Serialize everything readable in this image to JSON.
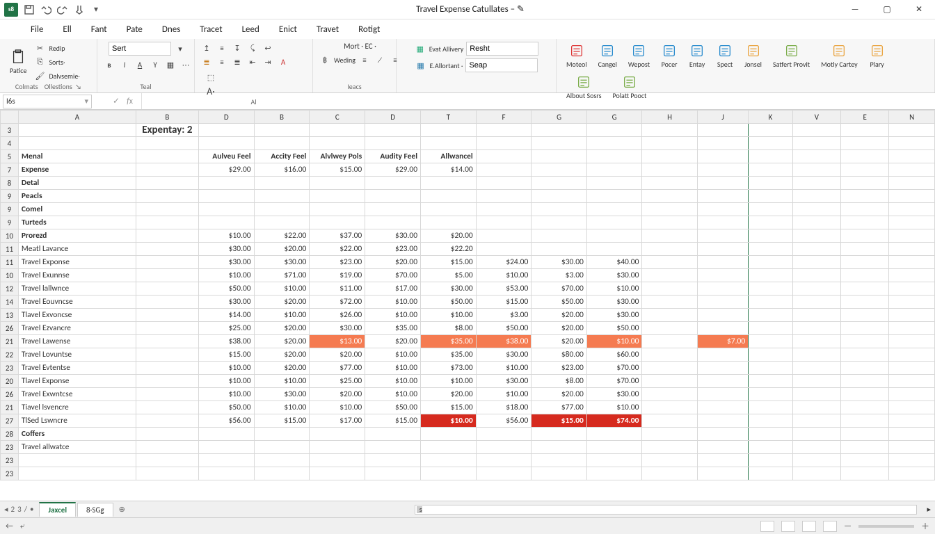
{
  "app": {
    "qat_label": "s8",
    "title": "Travel Expense Catullates  –  ✎"
  },
  "menu": [
    "File",
    "Ell",
    "Fant",
    "Pate",
    "Dnes",
    "Tracet",
    "Leed",
    "Enict",
    "Travet",
    "Rotigt"
  ],
  "ribbon": {
    "clip": {
      "paste": "Patice",
      "redo": "Redip",
      "sorts": "Sorts·",
      "delv": "Dalvsemie·"
    },
    "font": {
      "name": "Sert"
    },
    "g_clip_label": "Colmats",
    "g_clip_label2": "Ollestions",
    "g_font_label": "Teal",
    "g_align_label": "Al",
    "num": {
      "mort": "Mort · EC ·",
      "wed": "Weding",
      "label": "Ieacs"
    },
    "style": {
      "evat": "Evat Allivery",
      "eal": "E.Allortant ·",
      "combo1": "Resht",
      "combo2": "Seap"
    },
    "buttons": [
      "Moteol",
      "Cangel",
      "Wepost",
      "Pocer",
      "Entay",
      "Spect",
      "Jonsel",
      "Satfert Provit",
      "Motly Cartey",
      "Plary",
      "Albout Sosrs",
      "Polatt Pooct"
    ]
  },
  "namebox": "I6s",
  "columns": [
    "A",
    "B",
    "D",
    "B",
    "C",
    "D",
    "T",
    "F",
    "G",
    "G",
    "H",
    "J",
    "K",
    "V",
    "E",
    "N"
  ],
  "sheet": {
    "title": "Expentay: 2",
    "hdr": [
      "Menal",
      "",
      "Aulveu Feel",
      "Accity Feel",
      "Alvlwey Pols",
      "Audity Feel",
      "Allwancel"
    ],
    "rows": [
      {
        "n": "7",
        "a": "Expense",
        "v": [
          "$29.00",
          "$16.00",
          "$15.00",
          "$29.00",
          "$14.00"
        ],
        "bold": true
      },
      {
        "n": "8",
        "a": "Detal",
        "bold": true
      },
      {
        "n": "9",
        "a": "Peacls",
        "bold": true
      },
      {
        "n": "9",
        "a": "Comel",
        "bold": true
      },
      {
        "n": "9",
        "a": "Turteds",
        "bold": true
      },
      {
        "n": "10",
        "a": "Prorezd",
        "v": [
          "$10.00",
          "$22.00",
          "$37.00",
          "$30.00",
          "$20.00"
        ],
        "bold": true
      },
      {
        "n": "11",
        "a": "Meatl Lavance",
        "v": [
          "$30.00",
          "$20.00",
          "$22.00",
          "$23.00",
          "$22.20"
        ]
      },
      {
        "n": "11",
        "a": "Travel Exponse",
        "v": [
          "$30.00",
          "$30.00",
          "$23.00",
          "$20.00",
          "$15.00",
          "$24.00",
          "$30.00",
          "$40.00"
        ]
      },
      {
        "n": "10",
        "a": "Travel Exunnse",
        "v": [
          "$10.00",
          "$71.00",
          "$19.00",
          "$70.00",
          "$5.00",
          "$10.00",
          "$3.00",
          "$30.00"
        ]
      },
      {
        "n": "12",
        "a": "Travel lallwnce",
        "v": [
          "$50.00",
          "$10.00",
          "$11.00",
          "$17.00",
          "$30.00",
          "$53.00",
          "$70.00",
          "$10.00"
        ]
      },
      {
        "n": "14",
        "a": "Travel Eouvncse",
        "v": [
          "$30.00",
          "$20.00",
          "$72.00",
          "$10.00",
          "$50.00",
          "$15.00",
          "$50.00",
          "$30.00"
        ]
      },
      {
        "n": "13",
        "a": "Tlavel Exvoncse",
        "v": [
          "$14.00",
          "$10.00",
          "$26.00",
          "$10.00",
          "$10.00",
          "$3.00",
          "$20.00",
          "$30.00"
        ]
      },
      {
        "n": "26",
        "a": "Travel Ezvancre",
        "v": [
          "$25.00",
          "$20.00",
          "$30.00",
          "$35.00",
          "$8.00",
          "$50.00",
          "$20.00",
          "$50.00"
        ]
      },
      {
        "n": "21",
        "a": "Travel Lawense",
        "v": [
          "$38.00",
          "$20.00",
          "$13.00",
          "$20.00",
          "$35.00",
          "$38.00",
          "$20.00",
          "$10.00",
          "",
          "$7.00"
        ],
        "hl": {
          "2": "o",
          "4": "o",
          "5": "o",
          "7": "o",
          "9": "o"
        }
      },
      {
        "n": "22",
        "a": "Travel Lovuntse",
        "v": [
          "$15.00",
          "$20.00",
          "$20.00",
          "$10.00",
          "$35.00",
          "$30.00",
          "$80.00",
          "$60.00"
        ]
      },
      {
        "n": "23",
        "a": "Travel Evtentse",
        "v": [
          "$10.00",
          "$20.00",
          "$77.00",
          "$10.00",
          "$73.00",
          "$10.00",
          "$23.00",
          "$70.00"
        ]
      },
      {
        "n": "20",
        "a": "Tlavel Exponse",
        "v": [
          "$10.00",
          "$10.00",
          "$25.00",
          "$10.00",
          "$10.00",
          "$30.00",
          "$8.00",
          "$70.00"
        ]
      },
      {
        "n": "26",
        "a": "Travel Exwntcse",
        "v": [
          "$10.00",
          "$30.00",
          "$20.00",
          "$10.00",
          "$20.00",
          "$10.00",
          "$20.00",
          "$30.00"
        ]
      },
      {
        "n": "21",
        "a": "Tiavel lsvencre",
        "v": [
          "$50.00",
          "$10.00",
          "$10.00",
          "$50.00",
          "$15.00",
          "$18.00",
          "$77.00",
          "$10.00"
        ]
      },
      {
        "n": "27",
        "a": "TlSed Lswncre",
        "v": [
          "$56.00",
          "$15.00",
          "$17.00",
          "$15.00",
          "$10.00",
          "$56.00",
          "$15.00",
          "$74.00"
        ],
        "hl": {
          "4": "r",
          "6": "r",
          "7": "r"
        }
      },
      {
        "n": "28",
        "a": "Coffers",
        "bold": true
      },
      {
        "n": "23",
        "a": "Travel allwatce"
      },
      {
        "n": "23",
        "a": ""
      },
      {
        "n": "23",
        "a": ""
      }
    ]
  },
  "tabs": {
    "navsym": [
      "◂",
      "2",
      "3",
      "/",
      "•"
    ],
    "active": "Jaxcel",
    "other": "8·SGg"
  },
  "status": {
    "scroll_text": "s"
  }
}
